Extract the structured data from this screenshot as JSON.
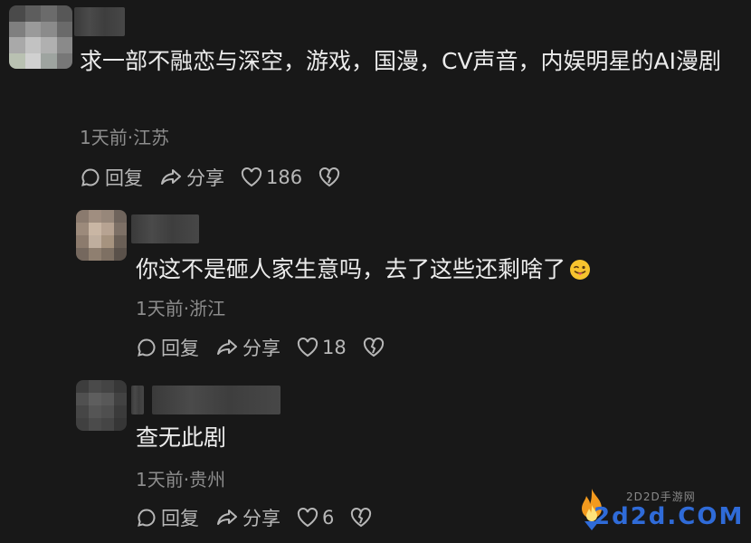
{
  "comments": [
    {
      "text": "求一部不融恋与深空，游戏，国漫，CV声音，内娱明星的AI漫剧",
      "meta": "1天前·江苏",
      "reply_label": "回复",
      "share_label": "分享",
      "likes": "186"
    },
    {
      "text": "你这不是砸人家生意吗，去了这些还剩啥了",
      "emoji": "wink-tongue-emoji",
      "meta": "1天前·浙江",
      "reply_label": "回复",
      "share_label": "分享",
      "likes": "18"
    },
    {
      "text": "查无此剧",
      "meta": "1天前·贵州",
      "reply_label": "回复",
      "share_label": "分享",
      "likes": "6"
    }
  ],
  "icons": {
    "reply": "comment-bubble-icon",
    "share": "share-arrow-icon",
    "like": "heart-icon",
    "dislike": "broken-heart-icon"
  },
  "watermark": {
    "site": "2D2D手游网",
    "domain": "2d2d.COM"
  },
  "colors": {
    "background": "#181818",
    "text": "#ececec",
    "meta": "#8d8d8d",
    "action": "#b7b7b7"
  }
}
